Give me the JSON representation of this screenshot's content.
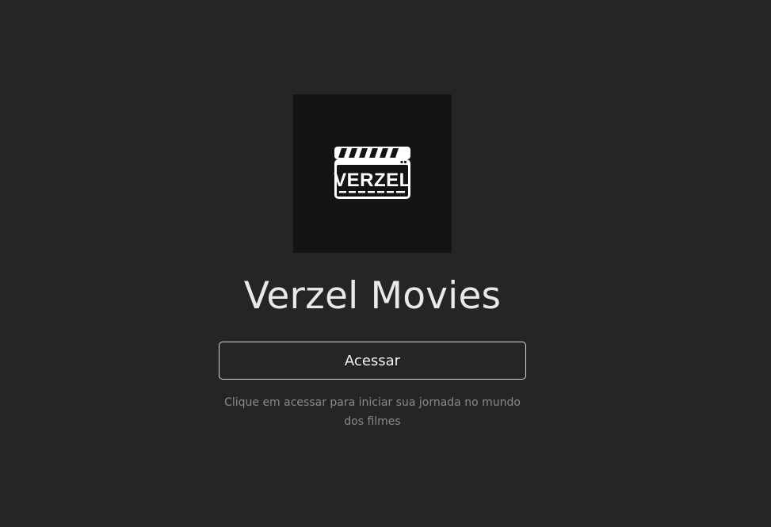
{
  "logo": {
    "name": "clapperboard-logo",
    "brand_text": "VERZEL"
  },
  "app_title": "Verzel Movies",
  "access_button_label": "Acessar",
  "hint": "Clique em acessar para iniciar sua jornada no mundo dos filmes",
  "colors": {
    "background": "#252525",
    "logo_background": "#141414",
    "title": "#e9e9e9",
    "button_border": "#d8d8d8",
    "hint": "#8a8a8a"
  }
}
